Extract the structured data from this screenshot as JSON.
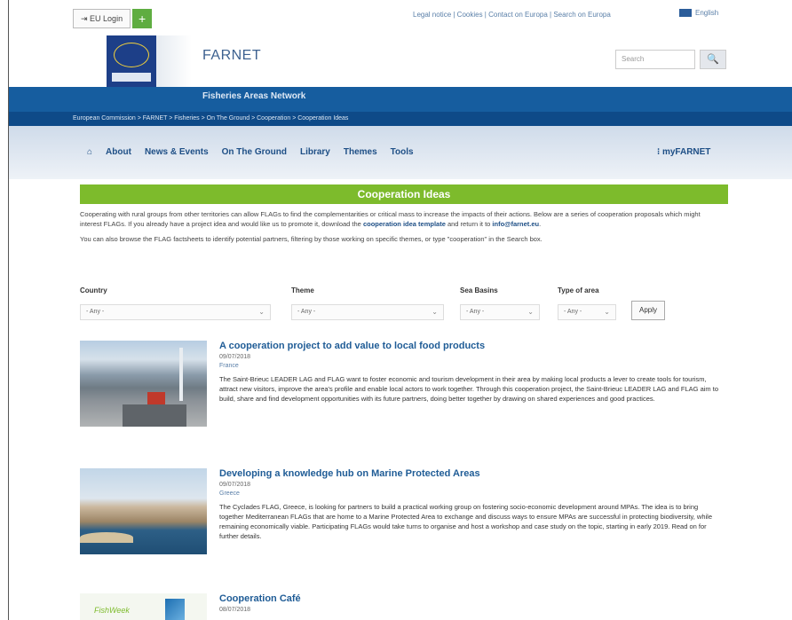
{
  "topbar": {
    "login_label": "EU Login",
    "plus_label": "+",
    "links": "Legal notice | Cookies | Contact on Europa | Search on Europa",
    "language": "English"
  },
  "header": {
    "site_name": "FARNET",
    "site_subtitle": "Fisheries Areas Network",
    "search_placeholder": "Search",
    "search_button": "🔍"
  },
  "breadcrumb": "European Commission > FARNET > Fisheries > On The Ground > Cooperation > Cooperation Ideas",
  "nav": {
    "home": "⌂",
    "items": [
      "About",
      "News & Events",
      "On The Ground",
      "Library",
      "Themes",
      "Tools"
    ],
    "my": "⁝ myFARNET"
  },
  "page_title": "Cooperation Ideas",
  "intro": {
    "p1_a": "Cooperating with rural groups from other territories can allow FLAGs to find the complementarities or critical mass to increase the impacts of their actions. Below are a series of cooperation proposals which might interest FLAGs. If you already have a project idea and would like us to promote it, download the ",
    "p1_link": "cooperation idea template",
    "p1_b": " and return it to ",
    "p1_email": "info@farnet.eu",
    "p1_c": ".",
    "p2": "You can also browse the FLAG factsheets to identify potential partners, filtering by those working on specific themes, or type \"cooperation\" in the Search box."
  },
  "filters": {
    "country_label": "Country",
    "country_value": "- Any -",
    "theme_label": "Theme",
    "theme_value": "- Any -",
    "seabasins_label": "Sea Basins",
    "seabasins_value": "- Any -",
    "typeofarea_label": "Type of area",
    "typeofarea_value": "- Any -",
    "apply": "Apply"
  },
  "articles": [
    {
      "title": "A cooperation project to add value to local food products",
      "date": "09/07/2018",
      "country": "France",
      "text": "The Saint-Brieuc LEADER LAG and FLAG want to foster economic and tourism development in their area by making local products a lever to create tools for tourism, attract new visitors, improve the area's profile and enable local actors to work together. Through this cooperation project, the Saint-Brieuc LEADER LAG and FLAG aim to build, share and find development opportunities with its future partners, doing better together by drawing on shared experiences and good practices."
    },
    {
      "title": "Developing a knowledge hub on Marine Protected Areas",
      "date": "09/07/2018",
      "country": "Greece",
      "text": "The Cyclades FLAG, Greece, is looking for partners to build a practical working group on fostering socio-economic development around MPAs. The idea is to bring together Mediterranean FLAGs that are home to a Marine Protected Area to exchange and discuss ways to ensure MPAs are successful in protecting biodiversity, while remaining economically viable. Participating FLAGs would take turns to organise and host a workshop and case study on the topic, starting in early 2019. Read on for further details."
    },
    {
      "title": "Cooperation Café",
      "date": "08/07/2018",
      "thumb_text": "FishWeek"
    }
  ],
  "colors": {
    "accent_green": "#7dbb2c",
    "brand_blue": "#165d9f",
    "link_blue": "#1f5c96"
  }
}
